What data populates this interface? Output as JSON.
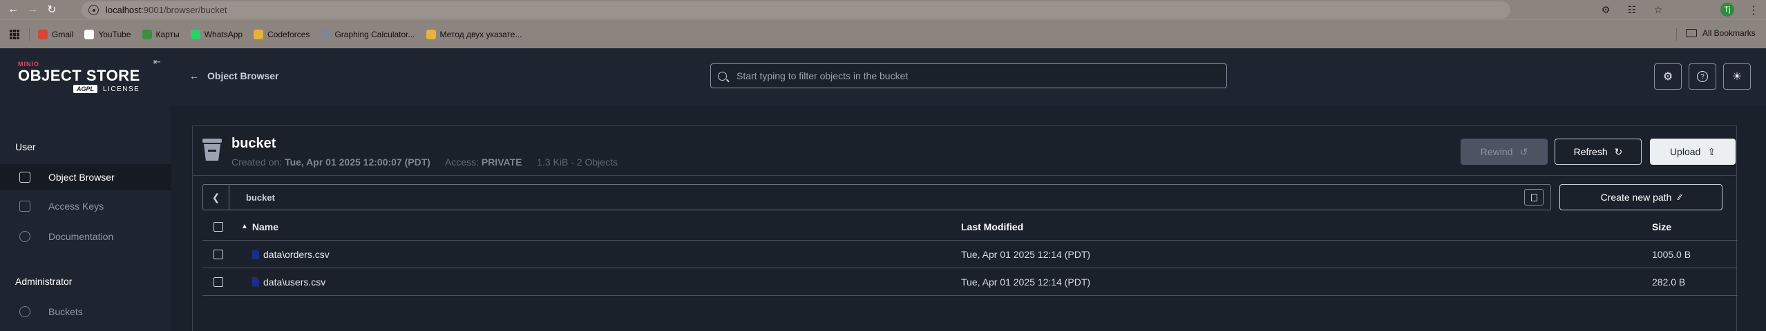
{
  "browser": {
    "url_host": "localhost",
    "url_path": ":9001/browser/bucket",
    "profile_initial": "Tj",
    "bookmarks": [
      {
        "label": "Gmail",
        "color": "#d44638"
      },
      {
        "label": "YouTube",
        "color": "#ffffff"
      },
      {
        "label": "Карты",
        "color": "#3c8f3c"
      },
      {
        "label": "WhatsApp",
        "color": "#25d366"
      },
      {
        "label": "Codeforces",
        "color": "#e8b33c"
      },
      {
        "label": "Graphing Calculator...",
        "color": "#7d8693"
      },
      {
        "label": "Метод двух указате...",
        "color": "#e8b33c"
      }
    ],
    "all_bookmarks": "All Bookmarks"
  },
  "sidebar": {
    "logo_minio": "MINIO",
    "logo_product": "OBJECT STORE",
    "logo_agpl": "AGPL",
    "logo_license": "LICENSE",
    "user_section": "User",
    "user_items": [
      {
        "label": "Object Browser",
        "icon": "folder-icon",
        "active": true
      },
      {
        "label": "Access Keys",
        "icon": "key-icon",
        "active": false
      },
      {
        "label": "Documentation",
        "icon": "docs-icon",
        "active": false
      }
    ],
    "admin_section": "Administrator",
    "admin_items": [
      {
        "label": "Buckets",
        "icon": "bucket-icon",
        "active": false
      }
    ]
  },
  "topbar": {
    "back_label": "Object Browser",
    "search_placeholder": "Start typing to filter objects in the bucket"
  },
  "bucket": {
    "name": "bucket",
    "created_label": "Created on:",
    "created_value": "Tue, Apr 01 2025 12:00:07 (PDT)",
    "access_label": "Access:",
    "access_value": "PRIVATE",
    "stats": "1.3 KiB - 2 Objects",
    "rewind_label": "Rewind",
    "refresh_label": "Refresh",
    "upload_label": "Upload"
  },
  "path": {
    "current": "bucket",
    "create_new_path_label": "Create new path"
  },
  "table": {
    "headers": {
      "name": "Name",
      "modified": "Last Modified",
      "size": "Size"
    },
    "rows": [
      {
        "name": "data\\orders.csv",
        "modified": "Tue, Apr 01 2025 12:14 (PDT)",
        "size": "1005.0 B"
      },
      {
        "name": "data\\users.csv",
        "modified": "Tue, Apr 01 2025 12:14 (PDT)",
        "size": "282.0 B"
      }
    ]
  }
}
